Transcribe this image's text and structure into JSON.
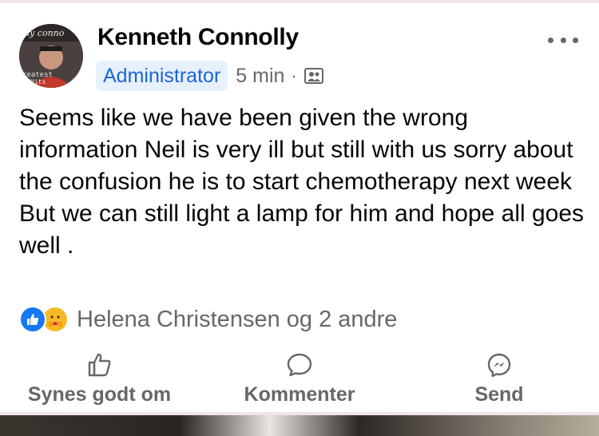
{
  "post": {
    "author": "Kenneth Connolly",
    "role_badge": "Administrator",
    "time": "5 min",
    "separator": "·",
    "audience_icon": "group-icon",
    "avatar_text_top": "ny conno",
    "avatar_text_bottom": "reatest",
    "avatar_text_bottom2": "Hits",
    "text": "Seems like we have been given the wrong information Neil is very ill but still with us sorry about the confusion he is to start chemotherapy next week\nBut we can still light a lamp for him and hope all goes well .",
    "reactions": {
      "icons": [
        "like-icon",
        "care-icon"
      ],
      "summary": "Helena Christensen og 2 andre"
    }
  },
  "actions": {
    "like_label": "Synes godt om",
    "comment_label": "Kommenter",
    "send_label": "Send"
  },
  "colors": {
    "accent": "#1877f2",
    "badge_bg": "#e7f0fd",
    "badge_text": "#1b66d6",
    "secondary_text": "#65676b"
  }
}
